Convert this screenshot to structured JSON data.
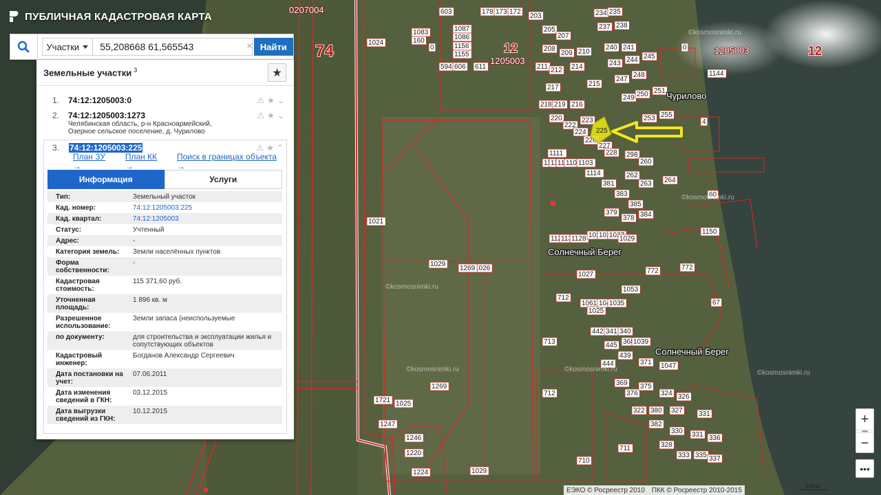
{
  "header": {
    "title": "ПУБЛИЧНАЯ КАДАСТРОВАЯ КАРТА"
  },
  "search": {
    "type_label": "Участки",
    "value": "55,208668 61,565543",
    "clear": "×",
    "find_label": "Найти",
    "icon": "search-icon"
  },
  "panel": {
    "title": "Земельные участки",
    "count": "3",
    "fav_icon": "star-icon",
    "results": [
      {
        "index": "1.",
        "cad": "74:12:1205003:0",
        "address": ""
      },
      {
        "index": "2.",
        "cad": "74:12:1205003:1273",
        "address_line1": "Челябинская область, р-н Красноармейский,",
        "address_line2": "Озерное сельское поселение, д. Чурилово"
      },
      {
        "index": "3.",
        "cad": "74:12:1205003:225"
      }
    ],
    "links": [
      "План ЗУ →",
      "План КК →",
      "Поиск в границах объекта →"
    ],
    "tabs": {
      "info": "Информация",
      "services": "Услуги"
    },
    "info": [
      {
        "key": "Тип:",
        "value": "Земельный участок"
      },
      {
        "key": "Кад. номер:",
        "value": "74:12:1205003:225"
      },
      {
        "key": "Кад. квартал:",
        "value": "74:12:1205003"
      },
      {
        "key": "Статус:",
        "value": "Учтенный"
      },
      {
        "key": "Адрес:",
        "value": "-"
      },
      {
        "key": "Категория земель:",
        "value": "Земли населённых пунктов"
      },
      {
        "key": "Форма собственности:",
        "value": "-"
      },
      {
        "key": "Кадастровая стоимость:",
        "value": "115 371,60 руб."
      },
      {
        "key": "Уточненная площадь:",
        "value": "1 896 кв. м"
      },
      {
        "key": "Разрешенное использование:",
        "value": "Земли запаса (неиспользуемые"
      },
      {
        "key": "по документу:",
        "value": "для строительства и эксплуатации жилья и сопутствующих объектов"
      },
      {
        "key": "Кадастровый инженер:",
        "value": "Богданов Александр Сергеевич"
      },
      {
        "key": "Дата постановки на учет:",
        "value": "07.06.2011"
      },
      {
        "key": "Дата изменения сведений в ГКН:",
        "value": "03.12.2015"
      },
      {
        "key": "Дата выгрузки сведений из ГКН:",
        "value": "10.12.2015"
      }
    ]
  },
  "map": {
    "region_74": "74",
    "region_12_a": "12",
    "region_12_b": "12",
    "quarter_a": "1205003",
    "quarter_b": "1205003",
    "quarter_c": "0207004",
    "place_churilovo": "Чурилово",
    "place_solnechny_1": "Солнечный Берег",
    "place_solnechny_2": "Солнечный Берег",
    "watermark": "©kosmosnimki.ru",
    "highlight_label": "225"
  },
  "controls": {
    "zoom_in": "+",
    "zoom_out": "−",
    "zoom_dots": "•••",
    "more": "•••"
  },
  "attribution": {
    "a": "ЕЭКО © Росреестр 2010",
    "b": "ПКК © Росреестр 2010-2015"
  },
  "scale": {
    "label": "100м"
  },
  "colors": {
    "accent": "#1e66c9",
    "boundary": "#d8282a",
    "highlight": "#e3e312"
  }
}
